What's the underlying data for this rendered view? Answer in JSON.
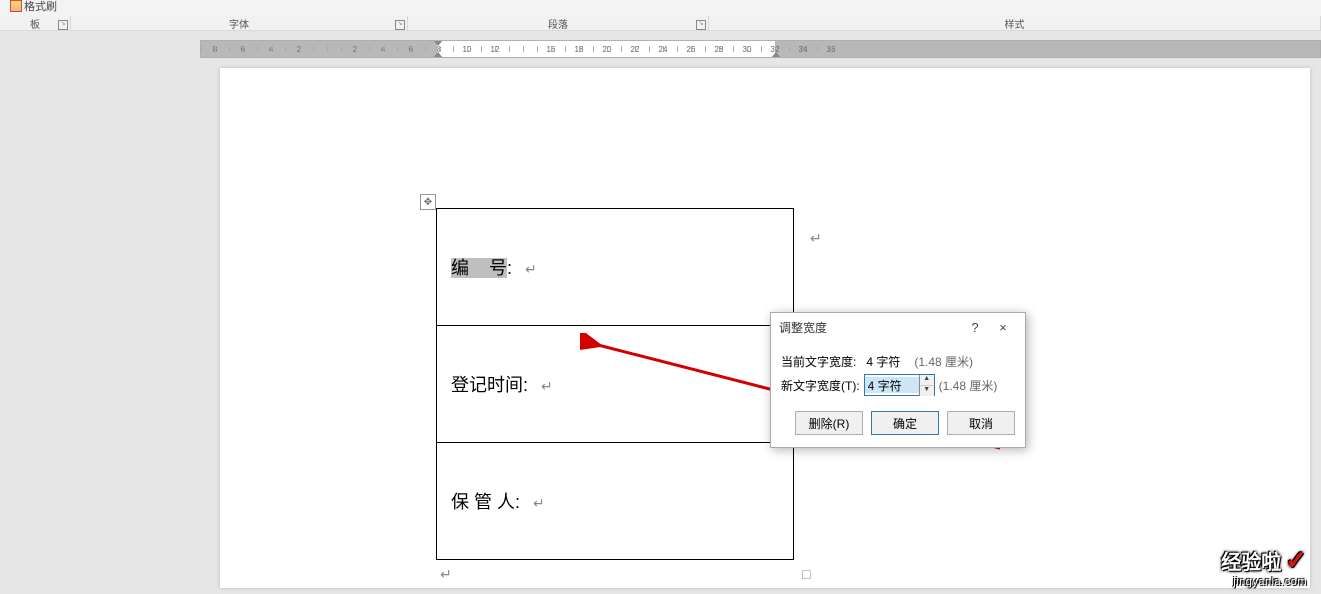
{
  "ribbon": {
    "clipboard_label": "板",
    "format_brush_label": "格式刷",
    "font_group": "字体",
    "para_group": "段落",
    "styles_group": "样式"
  },
  "ruler": {
    "ticks": [
      "8",
      "6",
      "4",
      "2",
      "",
      "2",
      "4",
      "6",
      "8",
      "10",
      "12",
      "",
      "16",
      "18",
      "20",
      "22",
      "24",
      "26",
      "28",
      "30",
      "32",
      "34",
      "36"
    ]
  },
  "table": {
    "rows": [
      {
        "label_parts": [
          "编",
          "号"
        ],
        "sep": ":"
      },
      {
        "label_parts": [
          "登记时间"
        ],
        "sep": ":"
      },
      {
        "label_parts": [
          "保 管 人"
        ],
        "sep": ":"
      }
    ]
  },
  "dialog": {
    "title": "调整宽度",
    "help": "?",
    "close": "×",
    "current_label": "当前文字宽度:",
    "current_value": "4 字符",
    "current_paren": "(1.48 厘米)",
    "new_label": "新文字宽度(T):",
    "new_value": "4 字符",
    "new_paren": "(1.48 厘米)",
    "delete_btn": "删除(R)",
    "ok_btn": "确定",
    "cancel_btn": "取消"
  },
  "watermark": {
    "line1": "经验啦",
    "line2": "jingyanla.com"
  }
}
